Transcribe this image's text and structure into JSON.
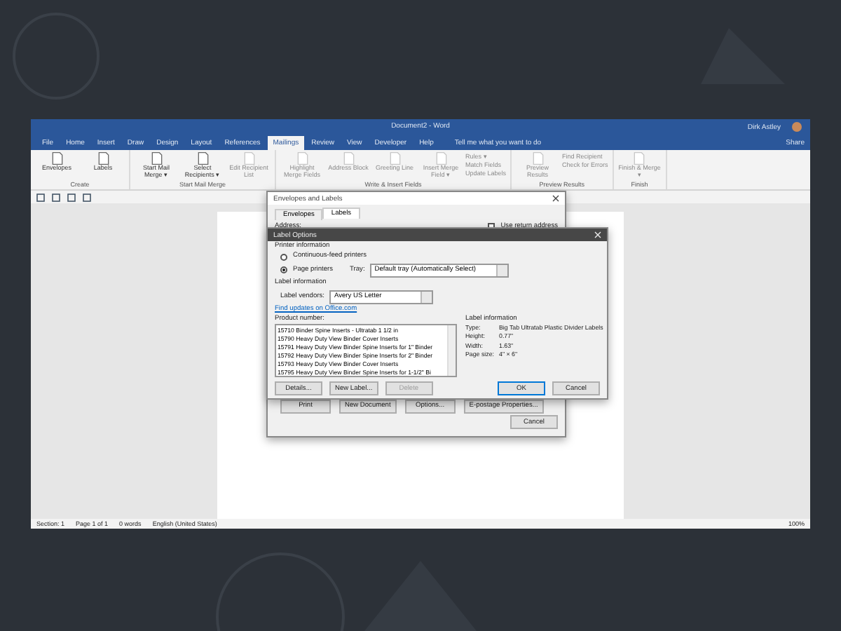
{
  "window": {
    "title": "Document2 - Word",
    "user": "Dirk Astley"
  },
  "tabs": [
    {
      "label": "File",
      "selected": false
    },
    {
      "label": "Home",
      "selected": false
    },
    {
      "label": "Insert",
      "selected": false
    },
    {
      "label": "Draw",
      "selected": false
    },
    {
      "label": "Design",
      "selected": false
    },
    {
      "label": "Layout",
      "selected": false
    },
    {
      "label": "References",
      "selected": false
    },
    {
      "label": "Mailings",
      "selected": true
    },
    {
      "label": "Review",
      "selected": false
    },
    {
      "label": "View",
      "selected": false
    },
    {
      "label": "Developer",
      "selected": false
    },
    {
      "label": "Help",
      "selected": false
    }
  ],
  "tell_me": "Tell me what you want to do",
  "share": "Share",
  "ribbon": [
    {
      "name": "Create",
      "commands": [
        {
          "kind": "large",
          "label": "Envelopes",
          "disabled": false
        },
        {
          "kind": "large",
          "label": "Labels",
          "disabled": false
        }
      ]
    },
    {
      "name": "Start Mail Merge",
      "commands": [
        {
          "kind": "large",
          "label": "Start Mail Merge ▾",
          "disabled": false
        },
        {
          "kind": "large",
          "label": "Select Recipients ▾",
          "disabled": false
        },
        {
          "kind": "large",
          "label": "Edit Recipient List",
          "disabled": true
        }
      ]
    },
    {
      "name": "Write & Insert Fields",
      "commands": [
        {
          "kind": "large",
          "label": "Highlight Merge Fields",
          "disabled": true
        },
        {
          "kind": "large",
          "label": "Address Block",
          "disabled": true
        },
        {
          "kind": "large",
          "label": "Greeting Line",
          "disabled": true
        },
        {
          "kind": "large",
          "label": "Insert Merge Field ▾",
          "disabled": true
        },
        {
          "kind": "small",
          "label": "Rules ▾",
          "disabled": true
        },
        {
          "kind": "small",
          "label": "Match Fields",
          "disabled": true
        },
        {
          "kind": "small",
          "label": "Update Labels",
          "disabled": true
        }
      ]
    },
    {
      "name": "Preview Results",
      "commands": [
        {
          "kind": "large",
          "label": "Preview Results",
          "disabled": true
        },
        {
          "kind": "small",
          "label": "Find Recipient",
          "disabled": true
        },
        {
          "kind": "small",
          "label": "Check for Errors",
          "disabled": true
        }
      ]
    },
    {
      "name": "Finish",
      "commands": [
        {
          "kind": "large",
          "label": "Finish & Merge ▾",
          "disabled": true
        }
      ]
    }
  ],
  "envelopes_dialog": {
    "title": "Envelopes and Labels",
    "tabs": [
      {
        "label": "Envelopes",
        "selected": false
      },
      {
        "label": "Labels",
        "selected": true
      }
    ],
    "address_label": "Address:",
    "use_return_address": {
      "label": "Use return address",
      "checked": false
    },
    "buttons": [
      "Print",
      "New Document",
      "Options...",
      "E-postage Properties...",
      "Cancel"
    ]
  },
  "label_options": {
    "title": "Label Options",
    "printer_heading": "Printer information",
    "printers": [
      {
        "label": "Continuous-feed printers",
        "selected": false
      },
      {
        "label": "Page printers",
        "selected": true
      }
    ],
    "tray_label": "Tray:",
    "tray_value": "Default tray (Automatically Select)",
    "label_heading": "Label information",
    "vendor_label": "Label vendors:",
    "vendor_value": "Avery US Letter",
    "link": "Find updates on Office.com",
    "product_heading": "Product number:",
    "products": [
      {
        "label": "15710 Binder Spine Inserts - Ultratab 1 1/2 in",
        "selected": false
      },
      {
        "label": "15790 Heavy Duty View Binder Cover Inserts",
        "selected": false
      },
      {
        "label": "15791 Heavy Duty View Binder Spine Inserts for 1\" Binder",
        "selected": false
      },
      {
        "label": "15792 Heavy Duty View Binder Spine Inserts for 2\" Binder",
        "selected": false
      },
      {
        "label": "15793 Heavy Duty View Binder Cover Inserts",
        "selected": false
      },
      {
        "label": "15795 Heavy Duty View Binder Spine Inserts for 1-1/2\" Bi",
        "selected": false
      }
    ],
    "info_heading": "Label information",
    "info": [
      {
        "key": "Type:",
        "value": "Big Tab Ultratab Plastic Divider Labels"
      },
      {
        "key": "Height:",
        "value": "0.77\""
      },
      {
        "key": "Width:",
        "value": "1.63\""
      },
      {
        "key": "Page size:",
        "value": "4\" × 6\""
      }
    ],
    "buttons": [
      {
        "label": "Details...",
        "disabled": false,
        "default": false
      },
      {
        "label": "New Label...",
        "disabled": false,
        "default": false
      },
      {
        "label": "Delete",
        "disabled": true,
        "default": false
      },
      {
        "label": "OK",
        "disabled": false,
        "default": true
      },
      {
        "label": "Cancel",
        "disabled": false,
        "default": false
      }
    ]
  },
  "status_bar": [
    "Section: 1",
    "Page 1 of 1",
    "0 words",
    "English (United States)"
  ],
  "zoom": "100%"
}
